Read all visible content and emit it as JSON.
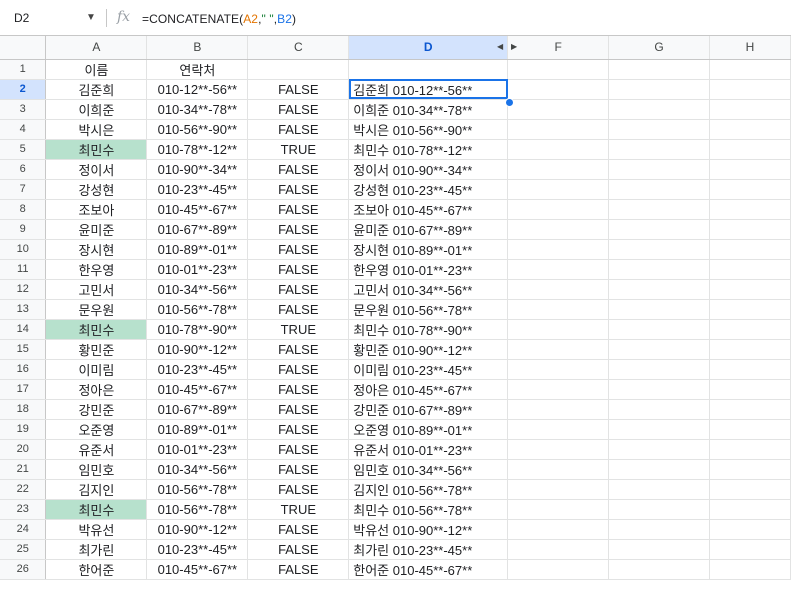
{
  "namebox": {
    "ref": "D2"
  },
  "formula": {
    "prefix": "=CONCATENATE(",
    "ref1": "A2",
    "sep1": ",",
    "str": "\" \"",
    "sep2": ",",
    "ref2": "B2",
    "suffix": ")"
  },
  "columns": [
    "A",
    "B",
    "C",
    "D",
    "F",
    "G",
    "H"
  ],
  "selected_column": "D",
  "selected_row": "2",
  "rows": [
    {
      "n": "1",
      "a": "이름",
      "b": "연락처",
      "c": "",
      "d": ""
    },
    {
      "n": "2",
      "a": "김준희",
      "b": "010-12**-56**",
      "c": "FALSE",
      "d": "김준희 010-12**-56**"
    },
    {
      "n": "3",
      "a": "이희준",
      "b": "010-34**-78**",
      "c": "FALSE",
      "d": "이희준 010-34**-78**"
    },
    {
      "n": "4",
      "a": "박시은",
      "b": "010-56**-90**",
      "c": "FALSE",
      "d": "박시은 010-56**-90**"
    },
    {
      "n": "5",
      "a": "최민수",
      "b": "010-78**-12**",
      "c": "TRUE",
      "d": "최민수 010-78**-12**",
      "hl": true
    },
    {
      "n": "6",
      "a": "정이서",
      "b": "010-90**-34**",
      "c": "FALSE",
      "d": "정이서 010-90**-34**"
    },
    {
      "n": "7",
      "a": "강성현",
      "b": "010-23**-45**",
      "c": "FALSE",
      "d": "강성현 010-23**-45**"
    },
    {
      "n": "8",
      "a": "조보아",
      "b": "010-45**-67**",
      "c": "FALSE",
      "d": "조보아 010-45**-67**"
    },
    {
      "n": "9",
      "a": "윤미준",
      "b": "010-67**-89**",
      "c": "FALSE",
      "d": "윤미준 010-67**-89**"
    },
    {
      "n": "10",
      "a": "장시현",
      "b": "010-89**-01**",
      "c": "FALSE",
      "d": "장시현 010-89**-01**"
    },
    {
      "n": "11",
      "a": "한우영",
      "b": "010-01**-23**",
      "c": "FALSE",
      "d": "한우영 010-01**-23**"
    },
    {
      "n": "12",
      "a": "고민서",
      "b": "010-34**-56**",
      "c": "FALSE",
      "d": "고민서 010-34**-56**"
    },
    {
      "n": "13",
      "a": "문우원",
      "b": "010-56**-78**",
      "c": "FALSE",
      "d": "문우원 010-56**-78**"
    },
    {
      "n": "14",
      "a": "최민수",
      "b": "010-78**-90**",
      "c": "TRUE",
      "d": "최민수 010-78**-90**",
      "hl": true
    },
    {
      "n": "15",
      "a": "황민준",
      "b": "010-90**-12**",
      "c": "FALSE",
      "d": "황민준 010-90**-12**"
    },
    {
      "n": "16",
      "a": "이미림",
      "b": "010-23**-45**",
      "c": "FALSE",
      "d": "이미림 010-23**-45**"
    },
    {
      "n": "17",
      "a": "정아은",
      "b": "010-45**-67**",
      "c": "FALSE",
      "d": "정아은 010-45**-67**"
    },
    {
      "n": "18",
      "a": "강민준",
      "b": "010-67**-89**",
      "c": "FALSE",
      "d": "강민준 010-67**-89**"
    },
    {
      "n": "19",
      "a": "오준영",
      "b": "010-89**-01**",
      "c": "FALSE",
      "d": "오준영 010-89**-01**"
    },
    {
      "n": "20",
      "a": "유준서",
      "b": "010-01**-23**",
      "c": "FALSE",
      "d": "유준서 010-01**-23**"
    },
    {
      "n": "21",
      "a": "임민호",
      "b": "010-34**-56**",
      "c": "FALSE",
      "d": "임민호 010-34**-56**"
    },
    {
      "n": "22",
      "a": "김지인",
      "b": "010-56**-78**",
      "c": "FALSE",
      "d": "김지인 010-56**-78**"
    },
    {
      "n": "23",
      "a": "최민수",
      "b": "010-56**-78**",
      "c": "TRUE",
      "d": "최민수 010-56**-78**",
      "hl": true
    },
    {
      "n": "24",
      "a": "박유선",
      "b": "010-90**-12**",
      "c": "FALSE",
      "d": "박유선 010-90**-12**"
    },
    {
      "n": "25",
      "a": "최가린",
      "b": "010-23**-45**",
      "c": "FALSE",
      "d": "최가린 010-23**-45**"
    },
    {
      "n": "26",
      "a": "한어준",
      "b": "010-45**-67**",
      "c": "FALSE",
      "d": "한어준 010-45**-67**"
    }
  ],
  "colors": {
    "highlight": "#b7e1cd",
    "selection": "#1a73e8",
    "header_selected": "#d3e3fd"
  },
  "icons": {
    "namebox_dropdown": "caret-down-icon",
    "fx": "function-icon",
    "hidden_col": "column-arrows-icon"
  }
}
